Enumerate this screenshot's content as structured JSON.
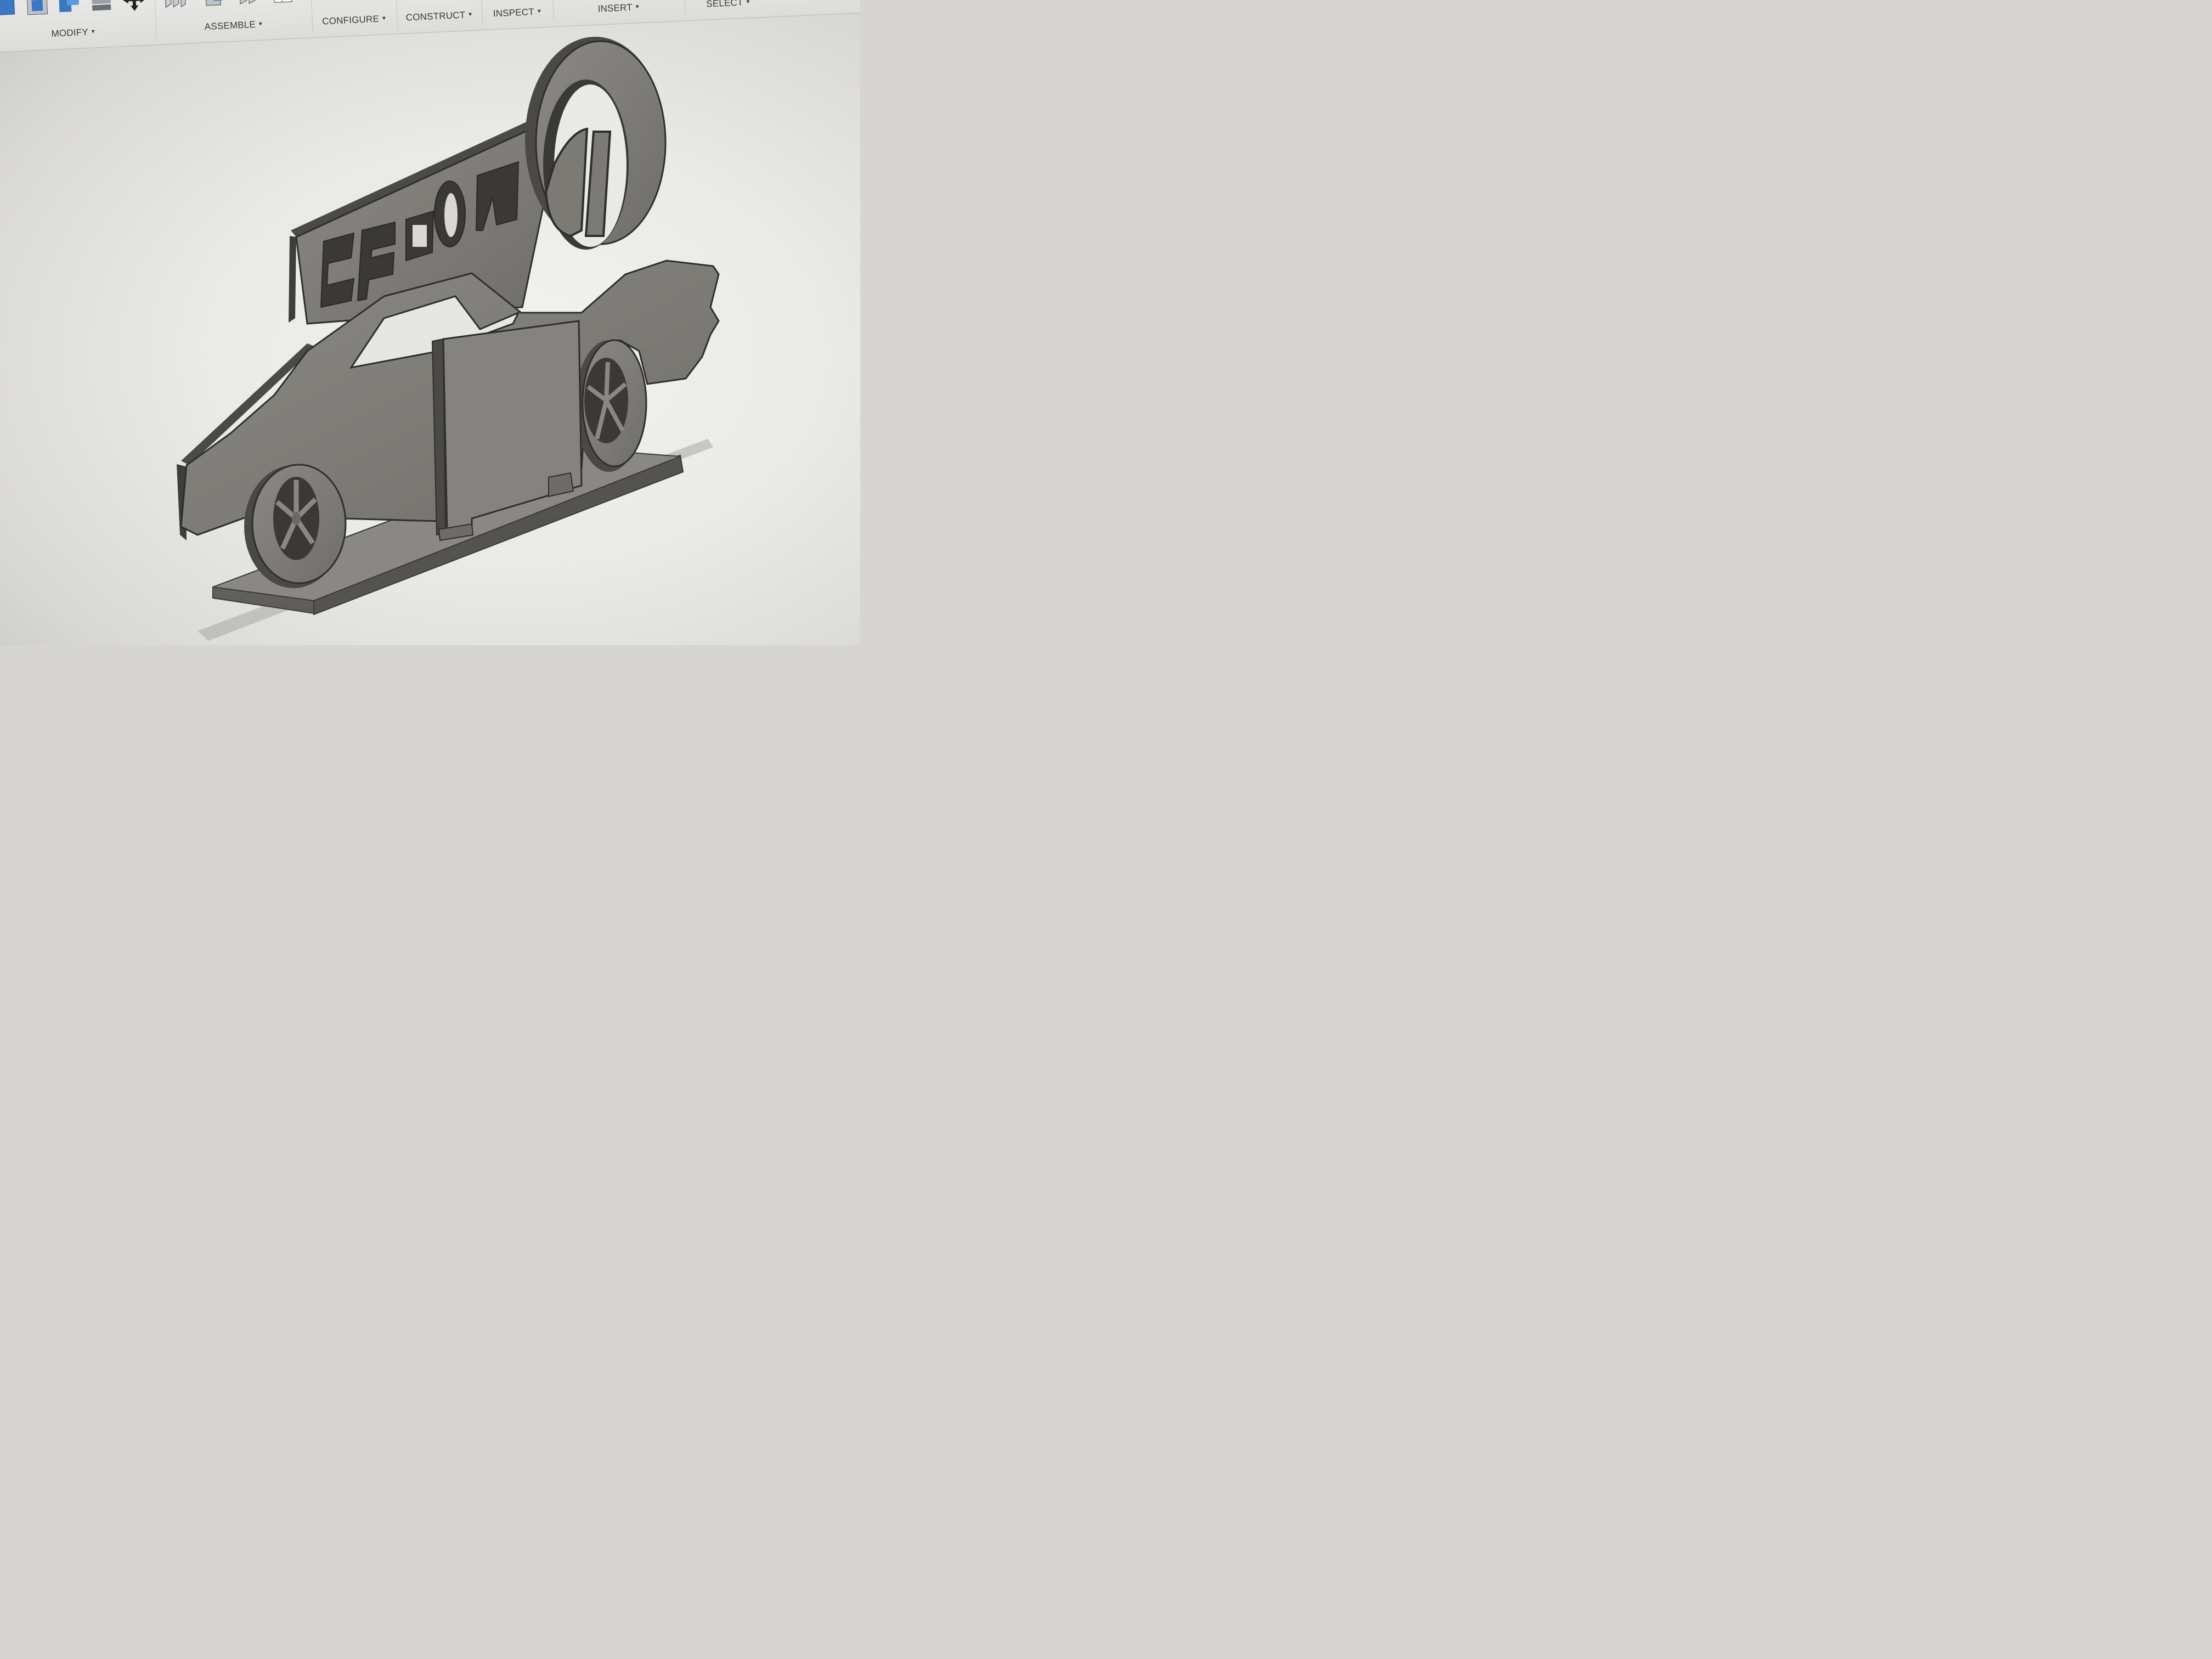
{
  "toolbar": {
    "groups": [
      {
        "label": "MODIFY"
      },
      {
        "label": "ASSEMBLE"
      },
      {
        "label": "CONFIGURE"
      },
      {
        "label": "CONSTRUCT"
      },
      {
        "label": "INSPECT"
      },
      {
        "label": "INSERT"
      },
      {
        "label": "SELECT"
      }
    ],
    "icons": {
      "press_pull": "press-pull-icon",
      "shell": "shell-icon",
      "combine": "combine-icon",
      "stack": "stack-icon",
      "move": "move-icon",
      "joint": "joint-icon",
      "new_component": "new-component-icon",
      "rigid_group": "rigid-group-icon",
      "table": "table-icon",
      "configure_params": "configure-params-icon",
      "configure_table": "configure-table-icon",
      "construct_plane": "construct-plane-icon"
    }
  },
  "model": {
    "sign_text": "MOPAR",
    "colors": {
      "face": "#807e79",
      "edge": "#3e3d3a",
      "side": "#5c5b57",
      "background": "#eeeeec",
      "shadow": "#9f9e9a"
    }
  }
}
